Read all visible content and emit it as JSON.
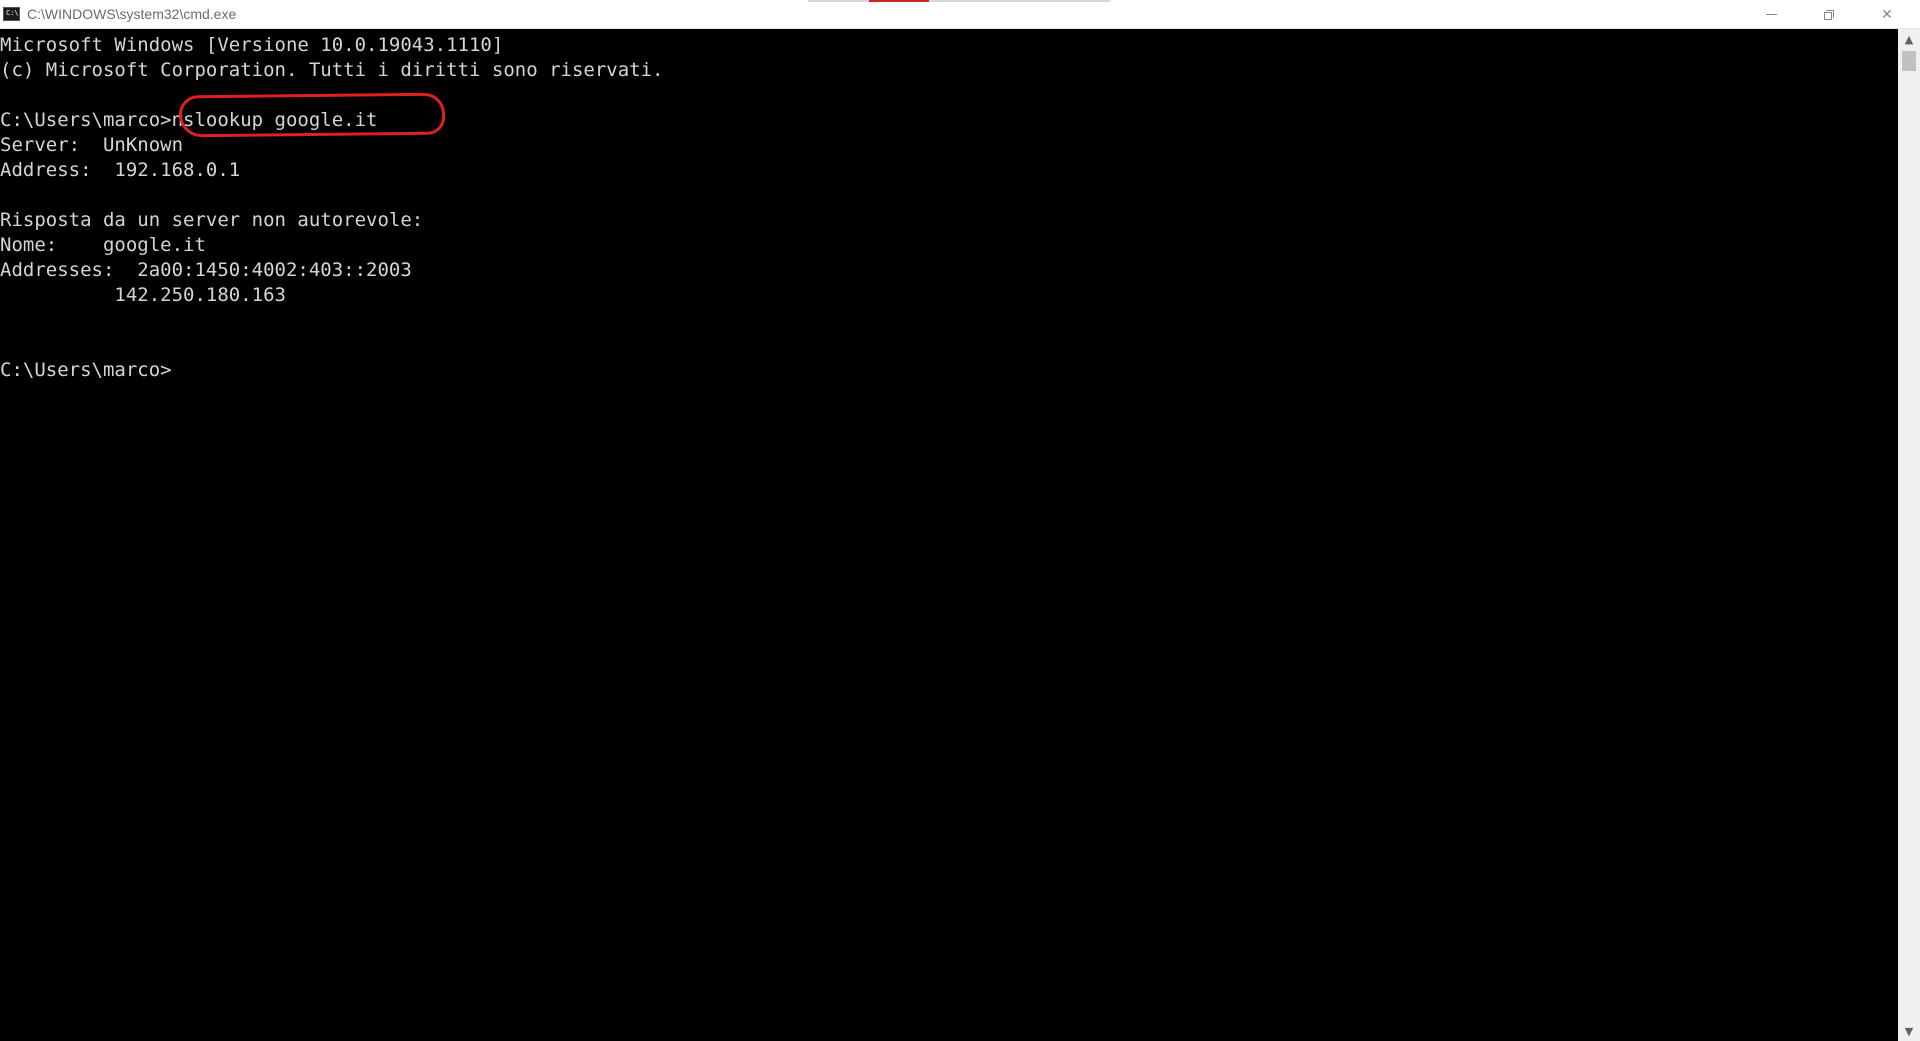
{
  "window": {
    "title": "C:\\WINDOWS\\system32\\cmd.exe",
    "icon": "cmd-icon",
    "icon_label": "C:\\",
    "controls": {
      "minimize": "minimize-icon",
      "maximize": "maximize-icon",
      "close_glyph": "✕"
    }
  },
  "console": {
    "lines": [
      "Microsoft Windows [Versione 10.0.19043.1110]",
      "(c) Microsoft Corporation. Tutti i diritti sono riservati.",
      "",
      "C:\\Users\\marco>nslookup google.it",
      "Server:  UnKnown",
      "Address:  192.168.0.1",
      "",
      "Risposta da un server non autorevole:",
      "Nome:    google.it",
      "Addresses:  2a00:1450:4002:403::2003",
      "          142.250.180.163",
      "",
      "",
      "C:\\Users\\marco>"
    ],
    "highlighted_command": "nslookup google.it",
    "highlight_color": "#e02020"
  },
  "scrollbar": {
    "up_glyph": "▲",
    "down_glyph": "▼"
  },
  "colors": {
    "console_bg": "#000000",
    "console_text": "#d4d4d4",
    "titlebar_bg": "#ffffff"
  }
}
